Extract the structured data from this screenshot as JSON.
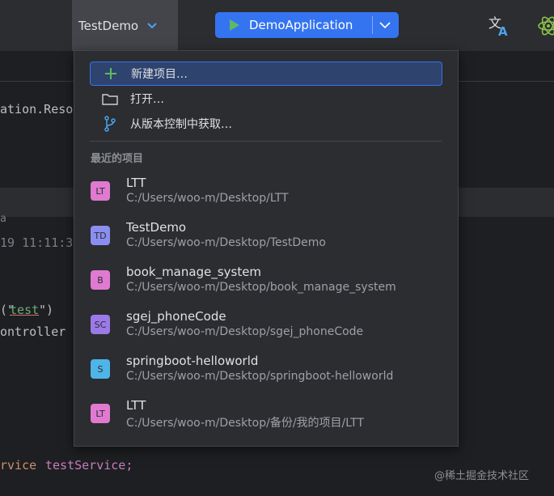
{
  "titlebar": {
    "project_name": "TestDemo",
    "run_config": "DemoApplication",
    "icons": [
      "translate-icon",
      "atom-icon"
    ]
  },
  "editor": {
    "lines": [
      {
        "text": "ation.Reso",
        "color": "#bcbec4"
      },
      {
        "text": "a",
        "color": "#7a7e85"
      },
      {
        "text": "19 11:11:3",
        "color": "#7a7e85"
      },
      {
        "text": "(\"",
        "color": "#bcbec4"
      },
      {
        "text": "test",
        "color": "#6aab73"
      },
      {
        "text": "\")",
        "color": "#bcbec4"
      },
      {
        "text": "ontroller",
        "color": "#bcbec4"
      },
      {
        "text": "rvice",
        "color": "#cf8e6d"
      },
      {
        "text": "testService;",
        "color": "#c77dbb"
      }
    ]
  },
  "menu": {
    "items": [
      {
        "label": "新建项目…",
        "icon": "plus-icon",
        "selected": true
      },
      {
        "label": "打开…",
        "icon": "folder-icon",
        "selected": false
      },
      {
        "label": "从版本控制中获取…",
        "icon": "vcs-branch-icon",
        "selected": false
      }
    ],
    "section_title": "最近的项目",
    "recent": [
      {
        "badge": "LT",
        "color": "#e07ad1",
        "name": "LTT",
        "path": "C:/Users/woo-m/Desktop/LTT"
      },
      {
        "badge": "TD",
        "color": "#8a8ef0",
        "name": "TestDemo",
        "path": "C:/Users/woo-m/Desktop/TestDemo"
      },
      {
        "badge": "B",
        "color": "#e07ad1",
        "name": "book_manage_system",
        "path": "C:/Users/woo-m/Desktop/book_manage_system"
      },
      {
        "badge": "SC",
        "color": "#9b7ae8",
        "name": "sgej_phoneCode",
        "path": "C:/Users/woo-m/Desktop/sgej_phoneCode"
      },
      {
        "badge": "S",
        "color": "#4fb4e8",
        "name": "springboot-helloworld",
        "path": "C:/Users/woo-m/Desktop/springboot-helloworld"
      },
      {
        "badge": "LT",
        "color": "#e07ad1",
        "name": "LTT",
        "path": "C:/Users/woo-m/Desktop/备份/我的项目/LTT"
      }
    ]
  },
  "watermark": "@稀土掘金技术社区"
}
